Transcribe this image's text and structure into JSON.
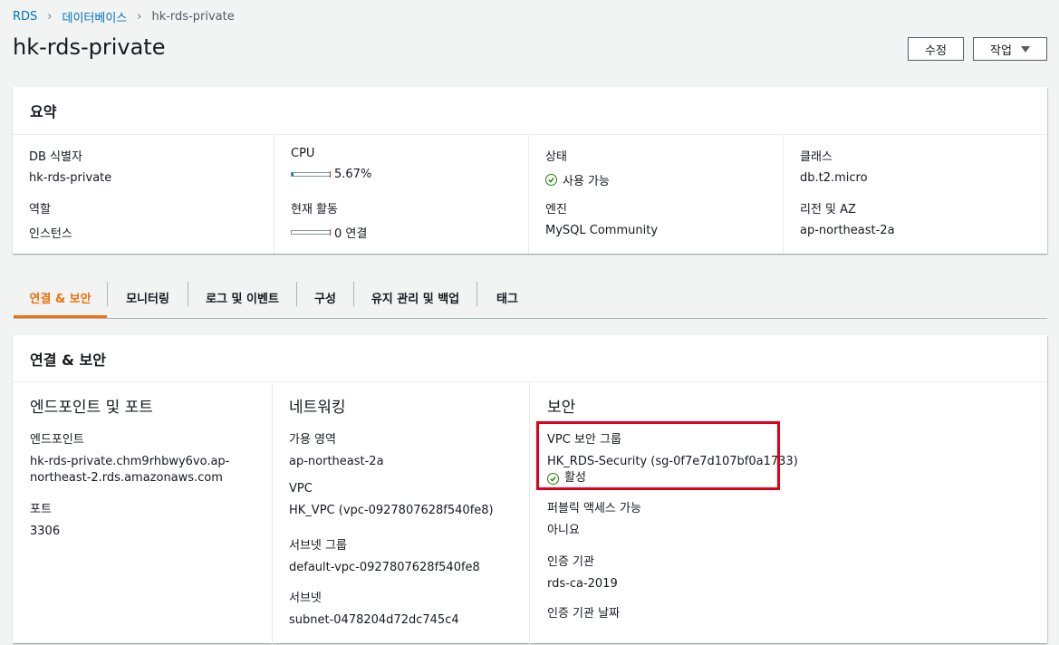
{
  "breadcrumb": {
    "root": "RDS",
    "databases": "데이터베이스",
    "current": "hk-rds-private"
  },
  "page_title": "hk-rds-private",
  "buttons": {
    "edit": "수정",
    "actions": "작업"
  },
  "summary": {
    "title": "요약",
    "db_identifier": {
      "label": "DB 식별자",
      "value": "hk-rds-private"
    },
    "role": {
      "label": "역할",
      "value": "인스턴스"
    },
    "cpu": {
      "label": "CPU",
      "value": "5.67%",
      "fraction": 0.0567
    },
    "activity": {
      "label": "현재 활동",
      "value": "0 연결",
      "fraction": 0
    },
    "status": {
      "label": "상태",
      "value": "사용 가능"
    },
    "engine": {
      "label": "엔진",
      "value": "MySQL Community"
    },
    "class": {
      "label": "클래스",
      "value": "db.t2.micro"
    },
    "region": {
      "label": "리전 및 AZ",
      "value": "ap-northeast-2a"
    }
  },
  "tabs": [
    "연결 & 보안",
    "모니터링",
    "로그 및 이벤트",
    "구성",
    "유지 관리 및 백업",
    "태그"
  ],
  "connectivity": {
    "title": "연결 & 보안",
    "endpoint_section": {
      "title": "엔드포인트 및 포트",
      "endpoint_label": "엔드포인트",
      "endpoint_line1": "hk-rds-private.chm9rhbwy6vo.ap-",
      "endpoint_line2": "northeast-2.rds.amazonaws.com",
      "port_label": "포트",
      "port_value": "3306"
    },
    "networking": {
      "title": "네트워킹",
      "az_label": "가용 영역",
      "az_value": "ap-northeast-2a",
      "vpc_label": "VPC",
      "vpc_value": "HK_VPC (vpc-0927807628f540fe8)",
      "subnet_group_label": "서브넷 그룹",
      "subnet_group_value": "default-vpc-0927807628f540fe8",
      "subnets_label": "서브넷",
      "subnets_value": "subnet-0478204d72dc745c4"
    },
    "security": {
      "title": "보안",
      "sg_label": "VPC 보안 그룹",
      "sg_value": "HK_RDS-Security (sg-0f7e7d107bf0a1733)",
      "sg_status": "활성",
      "public_label": "퍼블릭 액세스 가능",
      "public_value": "아니요",
      "ca_label": "인증 기관",
      "ca_value": "rds-ca-2019",
      "ca_date_label": "인증 기관 날짜"
    }
  },
  "colors": {
    "link": "#0073bb",
    "active_tab": "#ec7211",
    "success": "#1d8102",
    "highlight": "#e0001a"
  }
}
